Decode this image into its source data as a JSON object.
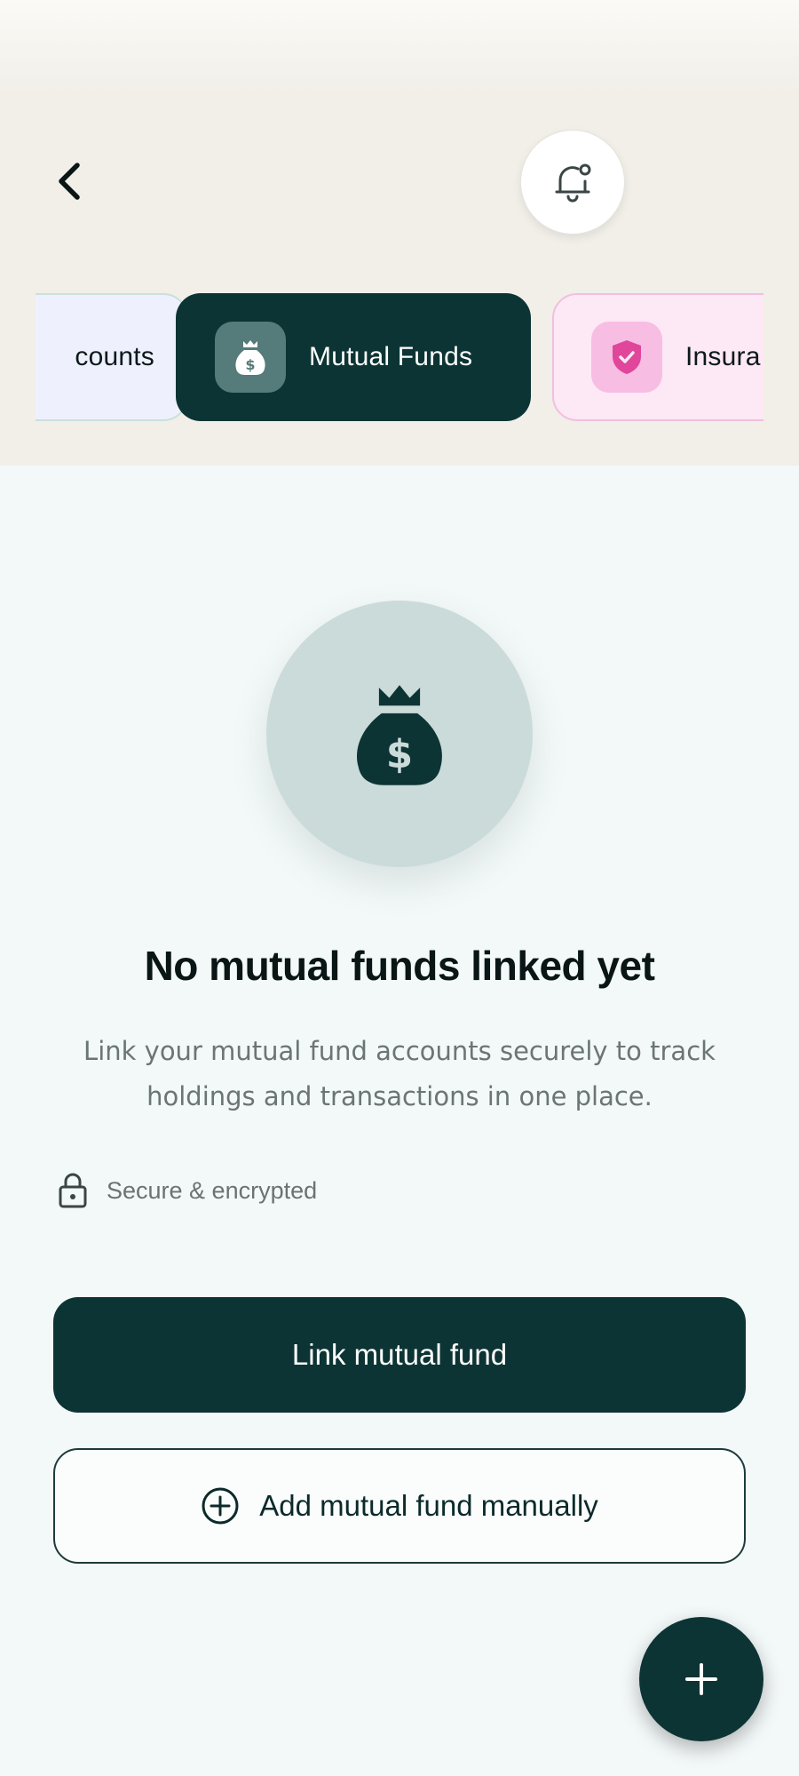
{
  "header": {
    "back_icon": "chevron-left-icon",
    "notification_icon": "bell-icon"
  },
  "tabs": [
    {
      "label": "counts",
      "state": "partial-left"
    },
    {
      "label": "Mutual Funds",
      "icon": "money-bag-icon",
      "state": "selected"
    },
    {
      "label": "Insura",
      "icon": "shield-check-icon",
      "state": "partial-right"
    }
  ],
  "empty_state": {
    "icon": "money-bag-icon",
    "title": "No mutual funds linked yet",
    "description": "Link your mutual fund accounts securely to track holdings and transactions in one place.",
    "secure_label": "Secure & encrypted",
    "secure_icon": "lock-icon"
  },
  "actions": {
    "primary_label": "Link mutual fund",
    "secondary_label": "Add mutual fund manually",
    "secondary_icon": "plus-circle-icon",
    "fab_icon": "plus-icon"
  },
  "colors": {
    "brand": "#0d3434",
    "header_bg": "#f1efe8",
    "page_bg": "#f3f8f8",
    "insurance_accent": "#e0469a"
  }
}
